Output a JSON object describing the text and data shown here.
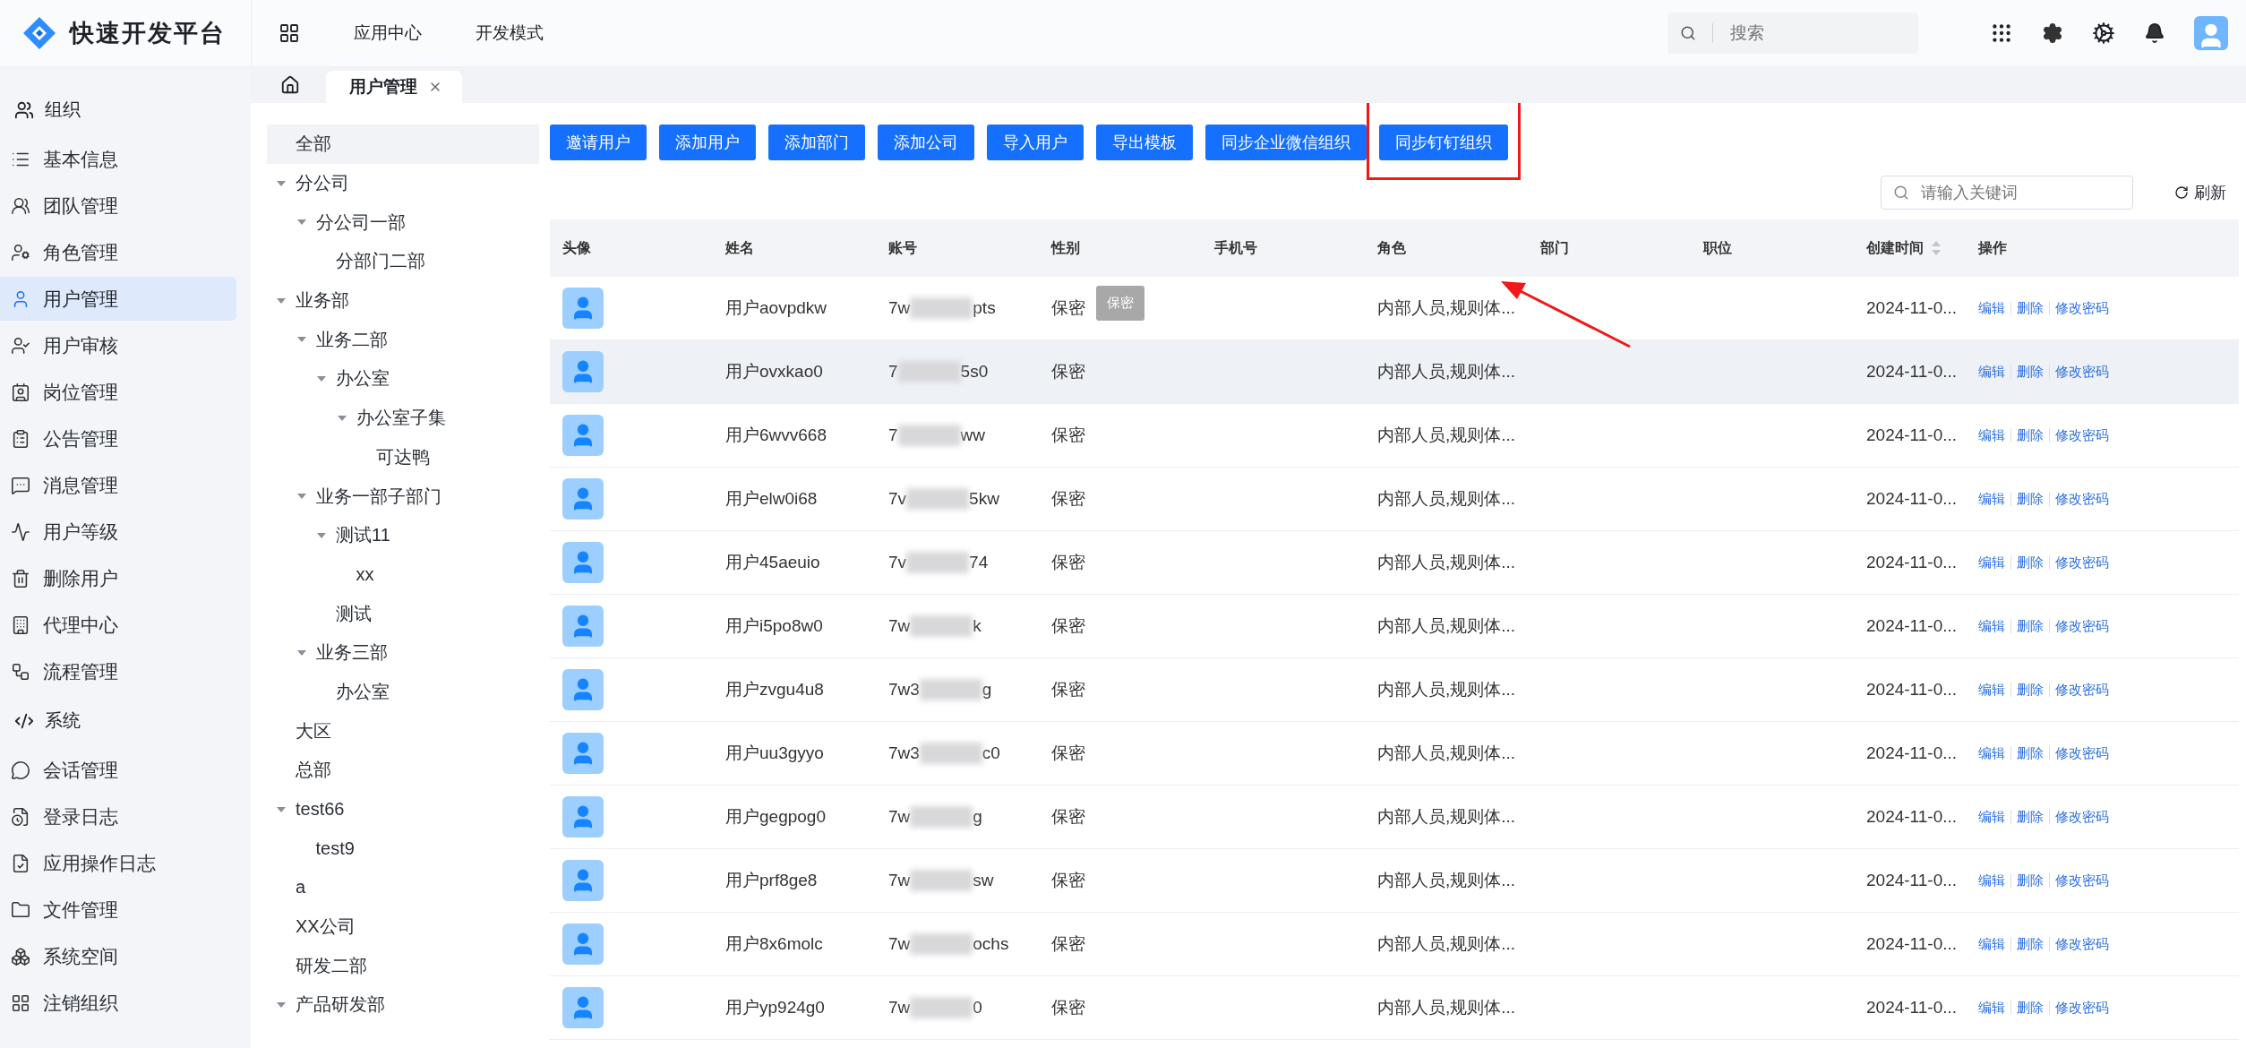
{
  "header": {
    "brand": "快速开发平台",
    "nav": [
      {
        "label": "应用中心"
      },
      {
        "label": "开发模式"
      }
    ],
    "search": {
      "placeholder": "搜索"
    }
  },
  "sidebar": [
    {
      "title": "组织",
      "items": [
        {
          "label": "基本信息",
          "selected": false
        },
        {
          "label": "团队管理",
          "selected": false
        },
        {
          "label": "角色管理",
          "selected": false
        },
        {
          "label": "用户管理",
          "selected": true
        },
        {
          "label": "用户审核",
          "selected": false
        },
        {
          "label": "岗位管理",
          "selected": false
        },
        {
          "label": "公告管理",
          "selected": false
        },
        {
          "label": "消息管理",
          "selected": false
        },
        {
          "label": "用户等级",
          "selected": false
        },
        {
          "label": "删除用户",
          "selected": false
        },
        {
          "label": "代理中心",
          "selected": false
        },
        {
          "label": "流程管理",
          "selected": false
        }
      ]
    },
    {
      "title": "系统",
      "items": [
        {
          "label": "会话管理",
          "selected": false
        },
        {
          "label": "登录日志",
          "selected": false
        },
        {
          "label": "应用操作日志",
          "selected": false
        },
        {
          "label": "文件管理",
          "selected": false
        },
        {
          "label": "系统空间",
          "selected": false
        },
        {
          "label": "注销组织",
          "selected": false
        }
      ]
    }
  ],
  "tabs": [
    {
      "label": "用户管理",
      "selected": true,
      "closable": true
    }
  ],
  "tree": [
    {
      "label": "全部",
      "selected": true
    },
    {
      "label": "分公司",
      "selected": false,
      "expanded": true,
      "children": [
        {
          "label": "分公司一部",
          "selected": false,
          "expanded": true,
          "children": [
            {
              "label": "分部门二部",
              "selected": false
            }
          ]
        }
      ]
    },
    {
      "label": "业务部",
      "selected": false,
      "expanded": true,
      "children": [
        {
          "label": "业务二部",
          "selected": false,
          "expanded": true,
          "children": [
            {
              "label": "办公室",
              "selected": false,
              "expanded": true,
              "children": [
                {
                  "label": "办公室子集",
                  "selected": false,
                  "expanded": true,
                  "children": [
                    {
                      "label": "可达鸭",
                      "selected": false
                    }
                  ]
                }
              ]
            }
          ]
        },
        {
          "label": "业务一部子部门",
          "selected": false,
          "expanded": true,
          "children": [
            {
              "label": "测试11",
              "selected": false,
              "expanded": true,
              "children": [
                {
                  "label": "xx",
                  "selected": false
                }
              ]
            },
            {
              "label": "测试",
              "selected": false
            }
          ]
        },
        {
          "label": "业务三部",
          "selected": false,
          "expanded": true,
          "children": [
            {
              "label": "办公室",
              "selected": false
            }
          ]
        }
      ]
    },
    {
      "label": "大区",
      "selected": false
    },
    {
      "label": "总部",
      "selected": false
    },
    {
      "label": "test66",
      "selected": false,
      "expanded": true,
      "children": [
        {
          "label": "test9",
          "selected": false
        }
      ]
    },
    {
      "label": "a",
      "selected": false
    },
    {
      "label": "XX公司",
      "selected": false
    },
    {
      "label": "研发二部",
      "selected": false
    },
    {
      "label": "产品研发部",
      "selected": false,
      "expanded": true
    }
  ],
  "toolbar": {
    "buttons": [
      {
        "label": "邀请用户",
        "highlighted": false
      },
      {
        "label": "添加用户",
        "highlighted": false
      },
      {
        "label": "添加部门",
        "highlighted": false
      },
      {
        "label": "添加公司",
        "highlighted": false
      },
      {
        "label": "导入用户",
        "highlighted": false
      },
      {
        "label": "导出模板",
        "highlighted": false
      },
      {
        "label": "同步企业微信组织",
        "highlighted": false
      },
      {
        "label": "同步钉钉组织",
        "highlighted": true
      }
    ],
    "search": {
      "placeholder": "请输入关键词"
    },
    "refresh": "刷新"
  },
  "table": {
    "columns": [
      {
        "label": "头像",
        "sortable": false
      },
      {
        "label": "姓名",
        "sortable": false
      },
      {
        "label": "账号",
        "sortable": false
      },
      {
        "label": "性别",
        "sortable": false
      },
      {
        "label": "手机号",
        "sortable": false
      },
      {
        "label": "角色",
        "sortable": false
      },
      {
        "label": "部门",
        "sortable": false
      },
      {
        "label": "职位",
        "sortable": false
      },
      {
        "label": "创建时间",
        "sortable": true
      },
      {
        "label": "操作",
        "sortable": false
      }
    ],
    "rows": [
      {
        "name": "用户aovpdkw",
        "account_start": "7w",
        "account_end": "pts",
        "gender": "保密",
        "role": "内部人员,规则体...",
        "created": "2024-11-0...",
        "actions": [
          "编辑",
          "删除",
          "修改密码"
        ],
        "hovered": false,
        "tooltip": "保密"
      },
      {
        "name": "用户ovxkao0",
        "account_start": "7",
        "account_end": "5s0",
        "gender": "保密",
        "role": "内部人员,规则体...",
        "created": "2024-11-0...",
        "actions": [
          "编辑",
          "删除",
          "修改密码"
        ],
        "hovered": true
      },
      {
        "name": "用户6wvv668",
        "account_start": "7",
        "account_end": "ww",
        "gender": "保密",
        "role": "内部人员,规则体...",
        "created": "2024-11-0...",
        "actions": [
          "编辑",
          "删除",
          "修改密码"
        ],
        "hovered": false
      },
      {
        "name": "用户elw0i68",
        "account_start": "7v",
        "account_end": "5kw",
        "gender": "保密",
        "role": "内部人员,规则体...",
        "created": "2024-11-0...",
        "actions": [
          "编辑",
          "删除",
          "修改密码"
        ],
        "hovered": false
      },
      {
        "name": "用户45aeuio",
        "account_start": "7v",
        "account_end": "74",
        "gender": "保密",
        "role": "内部人员,规则体...",
        "created": "2024-11-0...",
        "actions": [
          "编辑",
          "删除",
          "修改密码"
        ],
        "hovered": false
      },
      {
        "name": "用户i5po8w0",
        "account_start": "7w",
        "account_end": "k",
        "gender": "保密",
        "role": "内部人员,规则体...",
        "created": "2024-11-0...",
        "actions": [
          "编辑",
          "删除",
          "修改密码"
        ],
        "hovered": false
      },
      {
        "name": "用户zvgu4u8",
        "account_start": "7w3",
        "account_end": "g",
        "gender": "保密",
        "role": "内部人员,规则体...",
        "created": "2024-11-0...",
        "actions": [
          "编辑",
          "删除",
          "修改密码"
        ],
        "hovered": false
      },
      {
        "name": "用户uu3gyyo",
        "account_start": "7w3",
        "account_end": "c0",
        "gender": "保密",
        "role": "内部人员,规则体...",
        "created": "2024-11-0...",
        "actions": [
          "编辑",
          "删除",
          "修改密码"
        ],
        "hovered": false
      },
      {
        "name": "用户gegpog0",
        "account_start": "7w",
        "account_end": "g",
        "gender": "保密",
        "role": "内部人员,规则体...",
        "created": "2024-11-0...",
        "actions": [
          "编辑",
          "删除",
          "修改密码"
        ],
        "hovered": false
      },
      {
        "name": "用户prf8ge8",
        "account_start": "7w",
        "account_end": "sw",
        "gender": "保密",
        "role": "内部人员,规则体...",
        "created": "2024-11-0...",
        "actions": [
          "编辑",
          "删除",
          "修改密码"
        ],
        "hovered": false
      },
      {
        "name": "用户8x6molc",
        "account_start": "7w",
        "account_end": "ochs",
        "gender": "保密",
        "role": "内部人员,规则体...",
        "created": "2024-11-0...",
        "actions": [
          "编辑",
          "删除",
          "修改密码"
        ],
        "hovered": false
      },
      {
        "name": "用户yp924g0",
        "account_start": "7w",
        "account_end": "0",
        "gender": "保密",
        "role": "内部人员,规则体...",
        "created": "2024-11-0...",
        "actions": [
          "编辑",
          "删除",
          "修改密码"
        ],
        "hovered": false
      }
    ]
  }
}
